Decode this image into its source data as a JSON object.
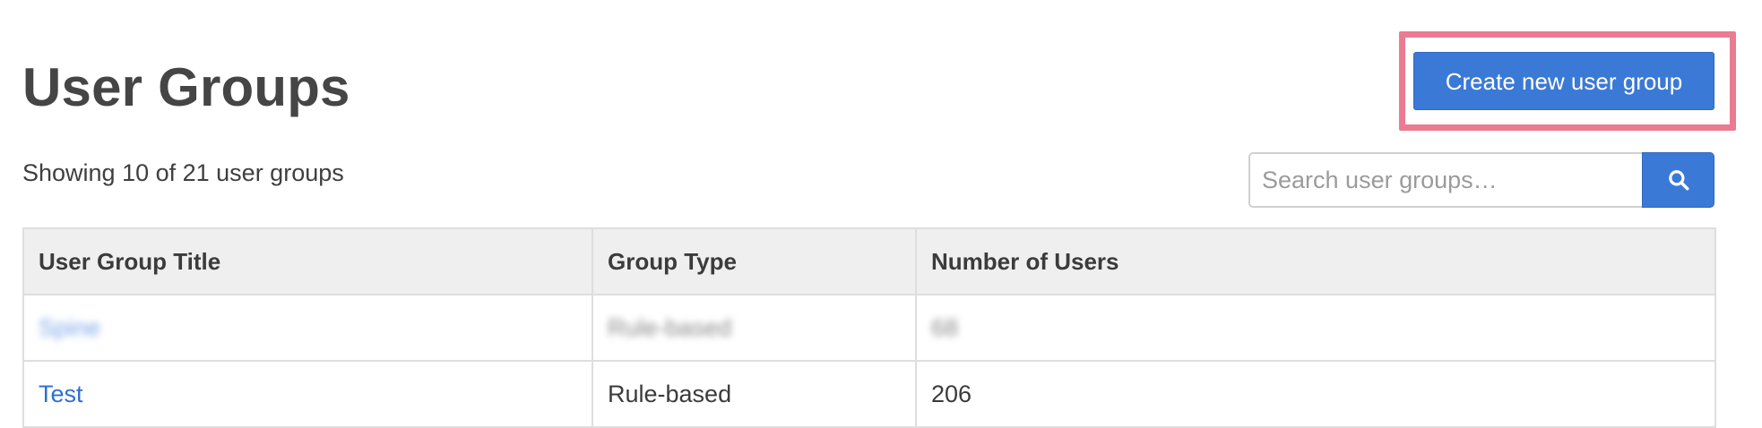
{
  "header": {
    "title": "User Groups",
    "create_button_label": "Create new user group"
  },
  "summary": {
    "count_text": "Showing 10 of 21 user groups"
  },
  "search": {
    "placeholder": "Search user groups…",
    "value": "",
    "button_icon": "search-icon"
  },
  "table": {
    "columns": [
      "User Group Title",
      "Group Type",
      "Number of Users"
    ],
    "rows": [
      {
        "title": "Spine",
        "type": "Rule-based",
        "users": "68",
        "blurred": true
      },
      {
        "title": "Test",
        "type": "Rule-based",
        "users": "206",
        "blurred": false
      }
    ]
  },
  "colors": {
    "primary": "#3b79d6",
    "link": "#2f6fcf",
    "highlight": "#ea7b91",
    "header_bg": "#efefef"
  }
}
